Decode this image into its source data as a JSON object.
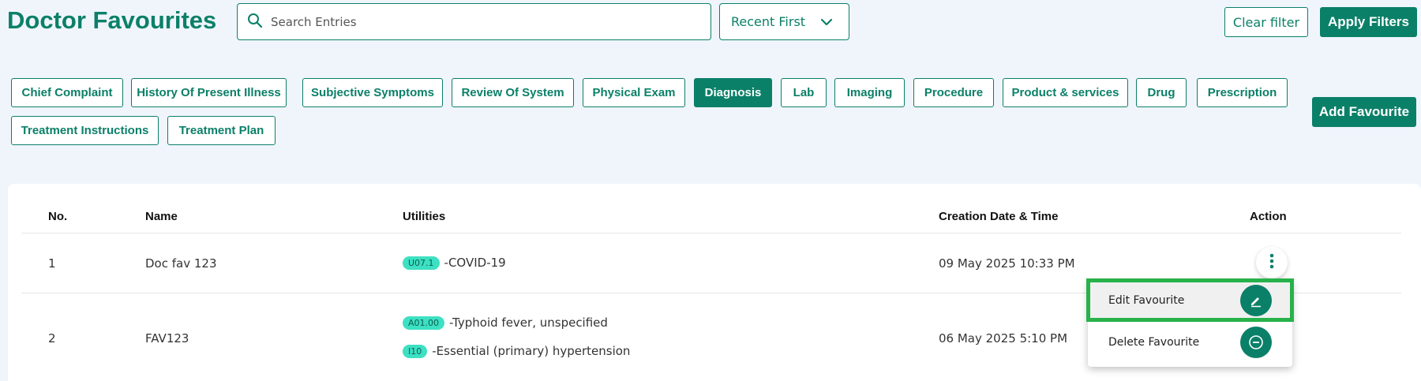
{
  "header": {
    "title": "Doctor Favourites",
    "search_placeholder": "Search Entries",
    "sort_label": "Recent First",
    "clear_filter": "Clear filter",
    "apply_filters": "Apply Filters"
  },
  "categories": {
    "items": [
      {
        "label": "Chief Complaint",
        "active": false
      },
      {
        "label": "History Of Present Illness",
        "active": false
      },
      {
        "label": "Subjective Symptoms",
        "active": false
      },
      {
        "label": "Review Of System",
        "active": false
      },
      {
        "label": "Physical Exam",
        "active": false
      },
      {
        "label": "Diagnosis",
        "active": true
      },
      {
        "label": "Lab",
        "active": false
      },
      {
        "label": "Imaging",
        "active": false
      },
      {
        "label": "Procedure",
        "active": false
      },
      {
        "label": "Product & services",
        "active": false
      },
      {
        "label": "Drug",
        "active": false
      },
      {
        "label": "Prescription",
        "active": false
      },
      {
        "label": "Treatment Instructions",
        "active": false
      },
      {
        "label": "Treatment Plan",
        "active": false
      }
    ],
    "add_button": "Add Favourite"
  },
  "table": {
    "headers": [
      "No.",
      "Name",
      "Utilities",
      "Creation Date & Time",
      "Action"
    ],
    "rows": [
      {
        "no": "1",
        "name": "Doc fav 123",
        "utilities": [
          {
            "code": "U07.1",
            "text": "-COVID-19"
          }
        ],
        "date": "09 May 2025 10:33 PM"
      },
      {
        "no": "2",
        "name": "FAV123",
        "utilities": [
          {
            "code": "A01.00",
            "text": "-Typhoid fever, unspecified"
          },
          {
            "code": "I10",
            "text": "-Essential (primary) hypertension"
          }
        ],
        "date": "06 May 2025 5:10 PM"
      }
    ]
  },
  "action_menu": {
    "edit": "Edit Favourite",
    "delete": "Delete Favourite"
  },
  "colors": {
    "brand": "#0b8068",
    "badge": "#3de0c2",
    "highlight_outline": "#27b24a",
    "background": "#f0f5fc"
  }
}
